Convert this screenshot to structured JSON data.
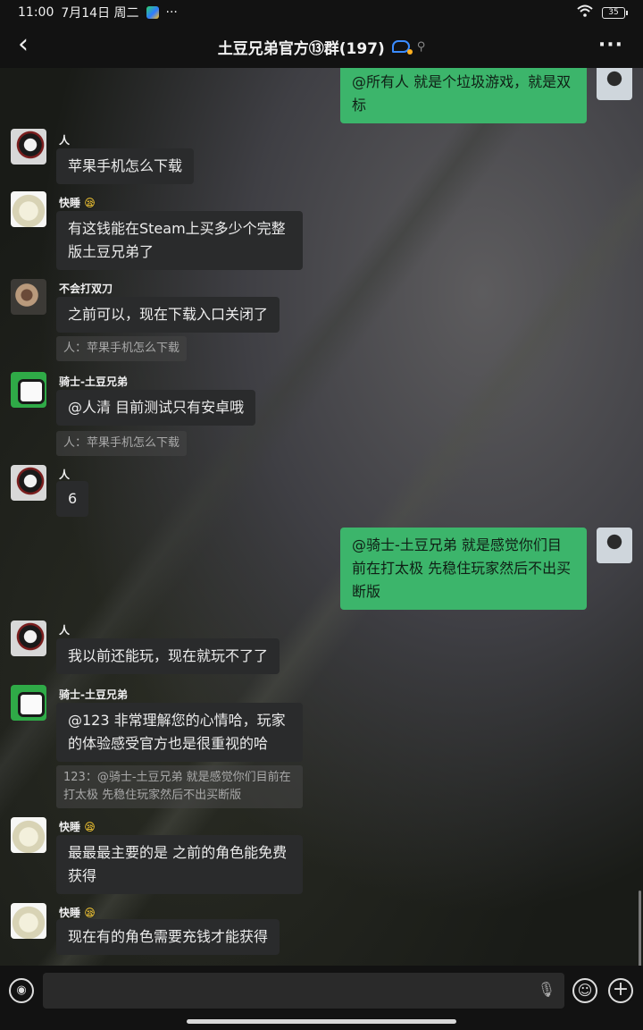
{
  "status": {
    "time": "11:00",
    "date": "7月14日 周二",
    "more": "···",
    "battery": "35"
  },
  "header": {
    "title": "土豆兄弟官方⑬群(197)",
    "back_icon": "back-arrow-icon",
    "more": "···"
  },
  "messages": [
    {
      "id": "m0",
      "sender": "",
      "mine": true,
      "text": "@所有人 就是个垃圾游戏，就是双标"
    },
    {
      "id": "m1",
      "sender": "人",
      "text": "苹果手机怎么下载"
    },
    {
      "id": "m2",
      "sender": "快睡",
      "emoji": "😪",
      "text": "有这钱能在Steam上买多少个完整版土豆兄弟了"
    },
    {
      "id": "m3",
      "sender": "不会打双刀",
      "text": "之前可以，现在下载入口关闭了",
      "quote": "人：苹果手机怎么下载"
    },
    {
      "id": "m4",
      "sender": "骑士-土豆兄弟",
      "text": "@人清 目前测试只有安卓哦",
      "quote": "人：苹果手机怎么下载"
    },
    {
      "id": "m5",
      "sender": "人",
      "text": "6"
    },
    {
      "id": "m6",
      "sender": "",
      "mine": true,
      "text": "@骑士-土豆兄弟  就是感觉你们目前在打太极 先稳住玩家然后不出买断版"
    },
    {
      "id": "m7",
      "sender": "人",
      "text": "我以前还能玩，现在就玩不了了"
    },
    {
      "id": "m8",
      "sender": "骑士-土豆兄弟",
      "text": "@123 非常理解您的心情哈，玩家的体验感受官方也是很重视的哈",
      "quote": "123：@骑士-土豆兄弟  就是感觉你们目前在打太极 先稳住玩家然后不出买断版"
    },
    {
      "id": "m9",
      "sender": "快睡",
      "emoji": "😪",
      "text": "最最最主要的是 之前的角色能免费获得"
    },
    {
      "id": "m10",
      "sender": "快睡",
      "emoji": "😪",
      "text": "现在有的角色需要充钱才能获得"
    }
  ],
  "input": {
    "placeholder": "",
    "voice_icon": "voice-icon",
    "mic_icon": "mic-icon",
    "emoji_icon": "emoji-icon",
    "plus_icon": "plus-icon"
  }
}
